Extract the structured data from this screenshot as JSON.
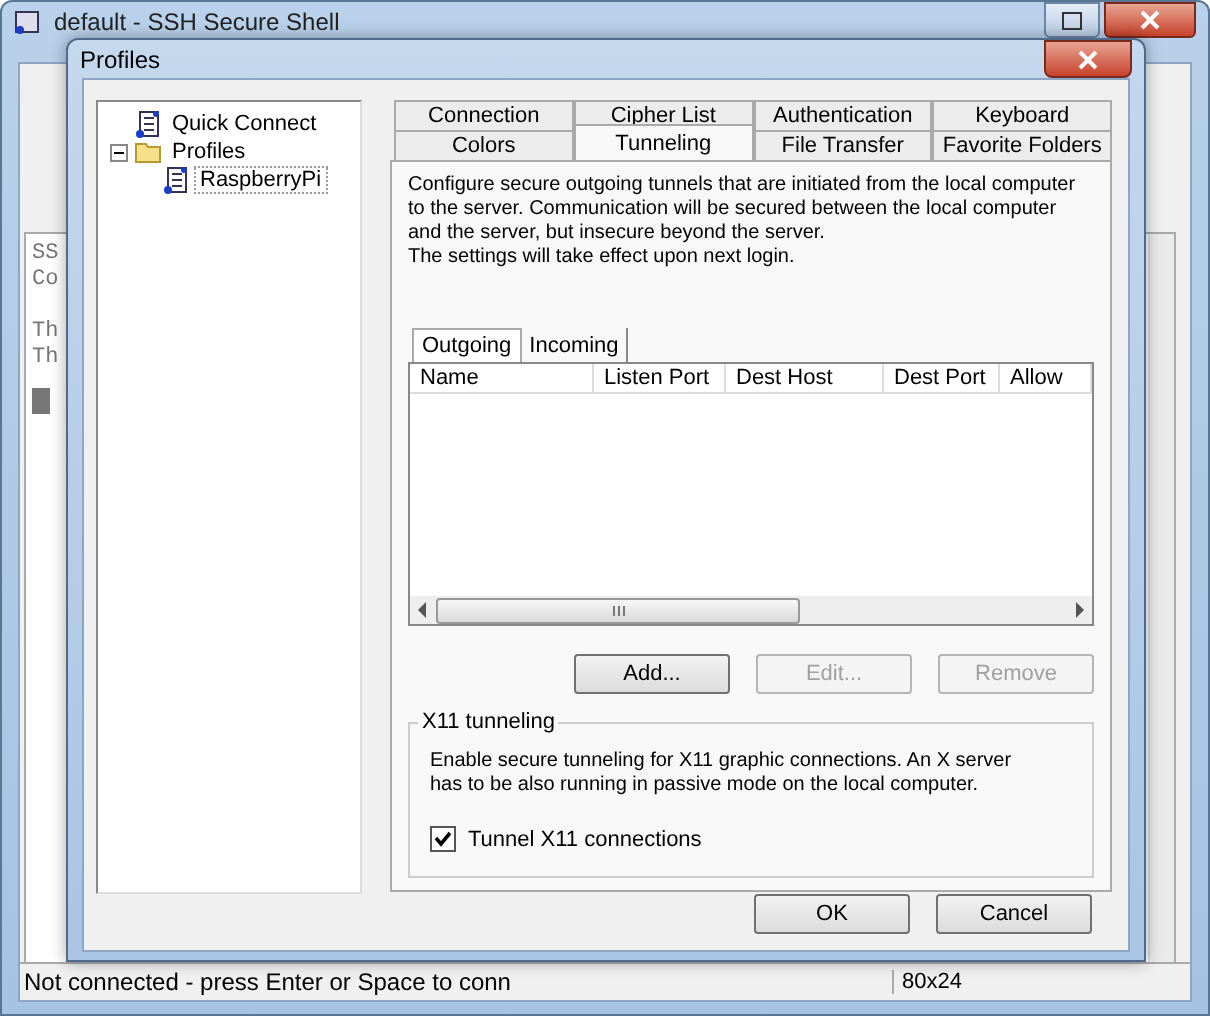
{
  "main_window": {
    "title": "default - SSH Secure Shell",
    "terminal_lines": [
      "SS",
      "Co",
      "Th",
      "Th"
    ],
    "status_bar": {
      "message": "Not connected - press Enter or Space to conn",
      "size": "80x24"
    }
  },
  "dialog": {
    "title": "Profiles",
    "tree": [
      {
        "label": "Quick Connect",
        "kind": "profile"
      },
      {
        "label": "Profiles",
        "kind": "folder",
        "expanded": true,
        "children": [
          {
            "label": "RaspberryPi",
            "kind": "profile"
          }
        ]
      }
    ],
    "tab_rows": [
      [
        {
          "label": "Connection",
          "selected": false
        },
        {
          "label": "Cipher List",
          "selected": false
        },
        {
          "label": "Authentication",
          "selected": false
        },
        {
          "label": "Keyboard",
          "selected": false
        }
      ],
      [
        {
          "label": "Colors",
          "selected": false
        },
        {
          "label": "Tunneling",
          "selected": true
        },
        {
          "label": "File Transfer",
          "selected": false
        },
        {
          "label": "Favorite Folders",
          "selected": false
        }
      ]
    ],
    "description": [
      "Configure secure outgoing tunnels that are initiated from the local computer",
      "to the server. Communication will be secured between the local computer",
      "and the server, but insecure beyond the server.",
      "The settings will take effect upon next login."
    ],
    "inner_tabs": [
      {
        "label": "Outgoing",
        "selected": true
      },
      {
        "label": "Incoming",
        "selected": false
      }
    ],
    "table": {
      "columns": [
        "Name",
        "Listen Port",
        "Dest Host",
        "Dest Port",
        "Allow"
      ]
    },
    "buttons": [
      {
        "label": "Add...",
        "disabled": false
      },
      {
        "label": "Edit...",
        "disabled": true
      },
      {
        "label": "Remove",
        "disabled": true
      }
    ],
    "x11": {
      "title": "X11 tunneling",
      "description": [
        "Enable secure tunneling for X11 graphic connections. An X server",
        "has to be also running in passive mode on the local computer."
      ],
      "checkbox": {
        "label": "Tunnel X11 connections",
        "checked": true
      }
    },
    "footer_buttons": [
      "OK",
      "Cancel"
    ]
  }
}
